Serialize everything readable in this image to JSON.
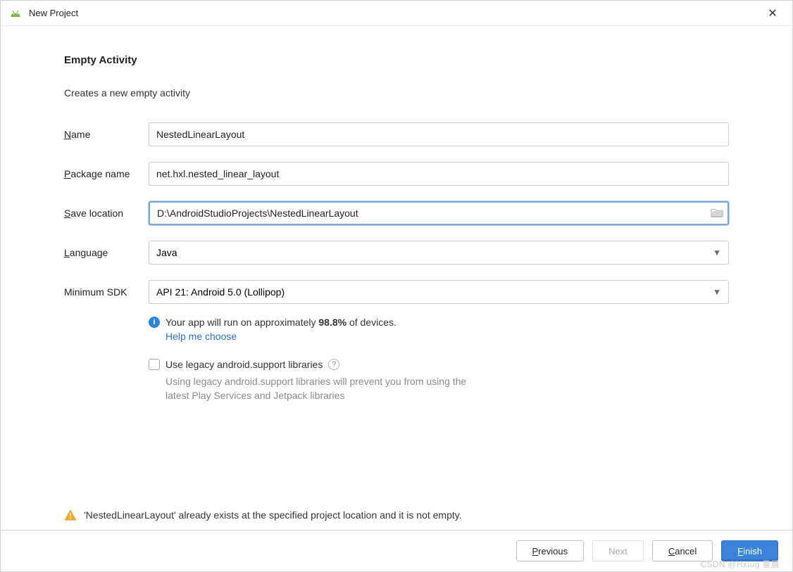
{
  "window": {
    "title": "New Project"
  },
  "page": {
    "heading": "Empty Activity",
    "description": "Creates a new empty activity"
  },
  "form": {
    "name": {
      "label_pre": "N",
      "label_rest": "ame",
      "value": "NestedLinearLayout"
    },
    "package": {
      "label_pre": "P",
      "label_rest": "ackage name",
      "value": "net.hxl.nested_linear_layout"
    },
    "save": {
      "label_pre": "S",
      "label_rest": "ave location",
      "value": "D:\\AndroidStudioProjects\\NestedLinearLayout"
    },
    "language": {
      "label_pre": "L",
      "label_rest": "anguage",
      "value": "Java"
    },
    "minsdk": {
      "label": "Minimum SDK",
      "value": "API 21: Android 5.0 (Lollipop)"
    }
  },
  "info": {
    "text_before": "Your app will run on approximately ",
    "percent": "98.8%",
    "text_after": " of devices.",
    "link": "Help me choose"
  },
  "legacy": {
    "label": "Use legacy android.support libraries",
    "desc": "Using legacy android.support libraries will prevent you from using the latest Play Services and Jetpack libraries"
  },
  "warning": "'NestedLinearLayout' already exists at the specified project location and it is not empty.",
  "buttons": {
    "previous_pre": "P",
    "previous_rest": "revious",
    "next": "Next",
    "cancel_pre": "C",
    "cancel_rest": "ancel",
    "finish_pre": "F",
    "finish_rest": "inish"
  },
  "watermark": "CSDN @HxIug 曼晨"
}
